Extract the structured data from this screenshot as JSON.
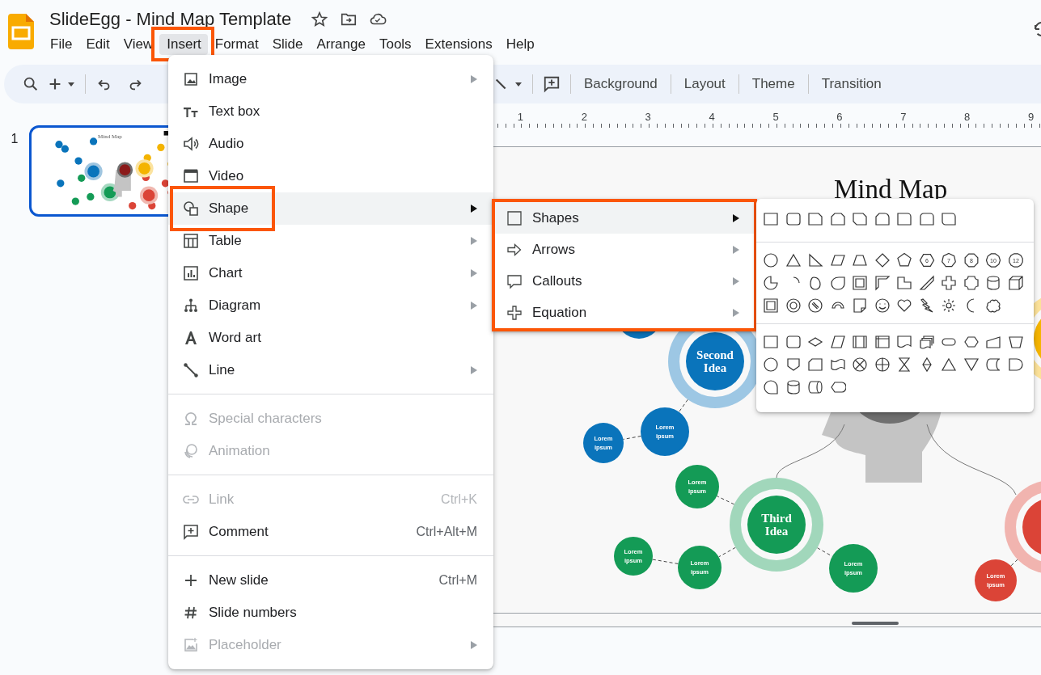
{
  "app": {
    "title": "SlideEgg - Mind Map Template"
  },
  "menu_bar": [
    {
      "label": "File",
      "selected": false,
      "highlighted": false
    },
    {
      "label": "Edit",
      "selected": false,
      "highlighted": false
    },
    {
      "label": "View",
      "selected": false,
      "highlighted": false
    },
    {
      "label": "Insert",
      "selected": true,
      "highlighted": true
    },
    {
      "label": "Format",
      "selected": false,
      "highlighted": false
    },
    {
      "label": "Slide",
      "selected": false,
      "highlighted": false
    },
    {
      "label": "Arrange",
      "selected": false,
      "highlighted": false
    },
    {
      "label": "Tools",
      "selected": false,
      "highlighted": false
    },
    {
      "label": "Extensions",
      "selected": false,
      "highlighted": false
    },
    {
      "label": "Help",
      "selected": false,
      "highlighted": false
    }
  ],
  "toolbar": {
    "buttons": [
      "Background",
      "Layout",
      "Theme",
      "Transition"
    ]
  },
  "filmstrip": [
    {
      "number": "1",
      "title": "Mind Map",
      "selected": true
    }
  ],
  "ruler": [
    "1",
    "2",
    "3",
    "4",
    "5",
    "6",
    "7",
    "8",
    "9"
  ],
  "slide": {
    "title": "Mind Map",
    "nodes": [
      {
        "kind": "idea",
        "label": "Second Idea",
        "color": "#0a74bb"
      },
      {
        "kind": "idea",
        "label": "Third Idea",
        "color": "#149b56"
      },
      {
        "kind": "idea",
        "color": "#db4437"
      },
      {
        "kind": "idea",
        "color": "#f4b400"
      },
      {
        "kind": "leaf",
        "label": "Lorem ipsum",
        "color": "#0a74bb"
      },
      {
        "kind": "leaf",
        "label": "Lorem ipsum",
        "color": "#0a74bb"
      },
      {
        "kind": "leaf",
        "label": "Lorem ipsum",
        "color": "#149b56"
      },
      {
        "kind": "leaf",
        "label": "Lorem ipsum",
        "color": "#149b56"
      },
      {
        "kind": "leaf",
        "label": "Lorem ipsum",
        "color": "#149b56"
      },
      {
        "kind": "leaf",
        "label": "Lorem ipsum",
        "color": "#149b56"
      },
      {
        "kind": "leaf",
        "label": "Lorem ipsum",
        "color": "#db4437"
      },
      {
        "kind": "leaf",
        "color": "#0a74bb"
      }
    ]
  },
  "insert_menu": {
    "groups": [
      [
        {
          "label": "Image",
          "submenu": true,
          "disabled": false,
          "selected": false,
          "highlighted": false
        },
        {
          "label": "Text box",
          "submenu": false,
          "disabled": false,
          "selected": false,
          "highlighted": false
        },
        {
          "label": "Audio",
          "submenu": false,
          "disabled": false,
          "selected": false,
          "highlighted": false
        },
        {
          "label": "Video",
          "submenu": false,
          "disabled": false,
          "selected": false,
          "highlighted": false
        },
        {
          "label": "Shape",
          "submenu": true,
          "disabled": false,
          "selected": true,
          "highlighted": true
        },
        {
          "label": "Table",
          "submenu": true,
          "disabled": false,
          "selected": false,
          "highlighted": false
        },
        {
          "label": "Chart",
          "submenu": true,
          "disabled": false,
          "selected": false,
          "highlighted": false
        },
        {
          "label": "Diagram",
          "submenu": true,
          "disabled": false,
          "selected": false,
          "highlighted": false
        },
        {
          "label": "Word art",
          "submenu": false,
          "disabled": false,
          "selected": false,
          "highlighted": false
        },
        {
          "label": "Line",
          "submenu": true,
          "disabled": false,
          "selected": false,
          "highlighted": false
        }
      ],
      [
        {
          "label": "Special characters",
          "submenu": false,
          "disabled": true,
          "selected": false,
          "highlighted": false
        },
        {
          "label": "Animation",
          "submenu": false,
          "disabled": true,
          "selected": false,
          "highlighted": false
        }
      ],
      [
        {
          "label": "Link",
          "shortcut": "Ctrl+K",
          "submenu": false,
          "disabled": true,
          "selected": false,
          "highlighted": false
        },
        {
          "label": "Comment",
          "shortcut": "Ctrl+Alt+M",
          "submenu": false,
          "disabled": false,
          "selected": false,
          "highlighted": false
        }
      ],
      [
        {
          "label": "New slide",
          "shortcut": "Ctrl+M",
          "submenu": false,
          "disabled": false,
          "selected": false,
          "highlighted": false
        },
        {
          "label": "Slide numbers",
          "submenu": false,
          "disabled": false,
          "selected": false,
          "highlighted": false
        },
        {
          "label": "Placeholder",
          "submenu": true,
          "disabled": true,
          "selected": false,
          "highlighted": false
        }
      ]
    ]
  },
  "shape_submenu": {
    "highlighted": true,
    "items": [
      {
        "label": "Shapes",
        "selected": true
      },
      {
        "label": "Arrows",
        "selected": false
      },
      {
        "label": "Callouts",
        "selected": false
      },
      {
        "label": "Equation",
        "selected": false
      }
    ]
  },
  "shapes_palette": {
    "polygon_numbers": [
      "6",
      "7",
      "8",
      "10",
      "12"
    ]
  }
}
